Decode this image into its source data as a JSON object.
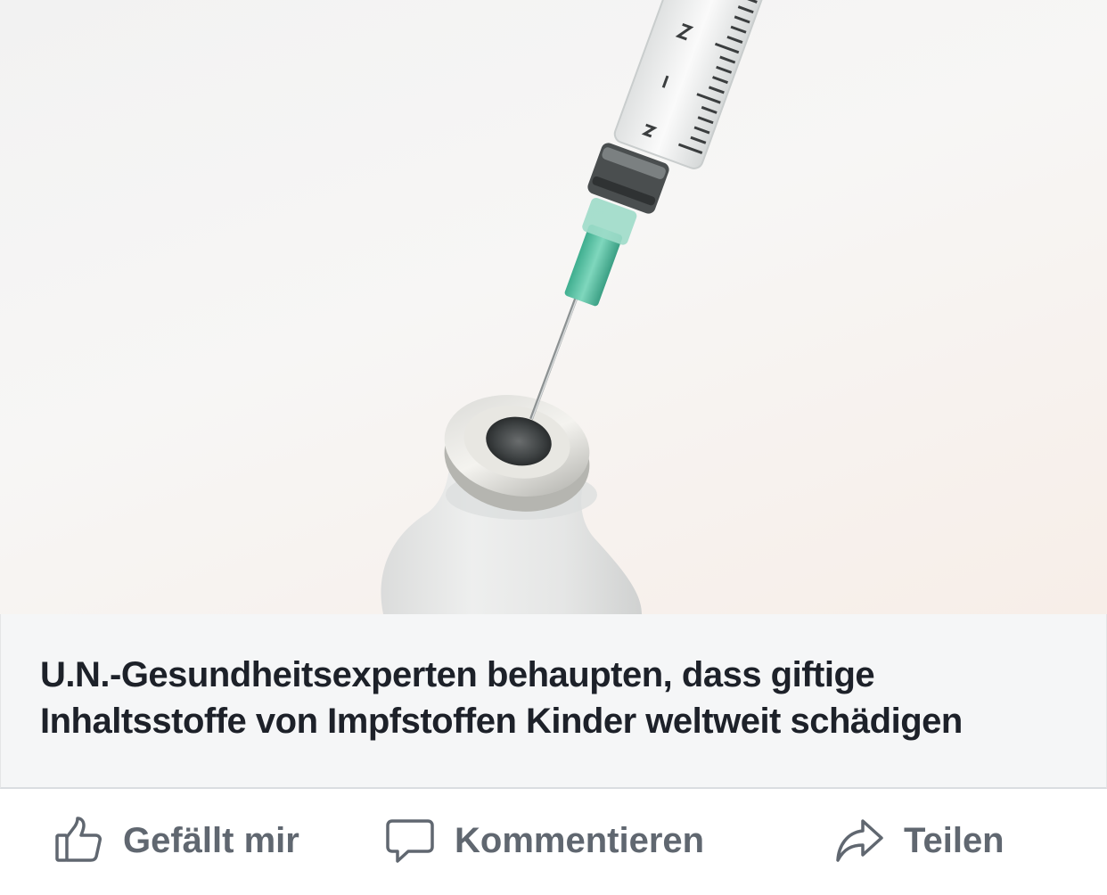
{
  "link_preview": {
    "image": {
      "subject": "syringe-needle-inserted-into-vaccine-vial"
    },
    "title": "U.N.-Gesundheitsexperten behaupten, dass giftige Inhaltsstoffe von Impfstoffen Kinder weltweit schädigen"
  },
  "actions": {
    "like": {
      "label": "Gefällt mir",
      "icon": "thumbs-up-icon"
    },
    "comment": {
      "label": "Kommentieren",
      "icon": "speech-bubble-icon"
    },
    "share": {
      "label": "Teilen",
      "icon": "share-arrow-icon"
    }
  },
  "colors": {
    "title_text": "#1d2129",
    "action_text": "#606770",
    "caption_background": "#f5f6f7",
    "needle_hub": "#5fc4a6"
  }
}
